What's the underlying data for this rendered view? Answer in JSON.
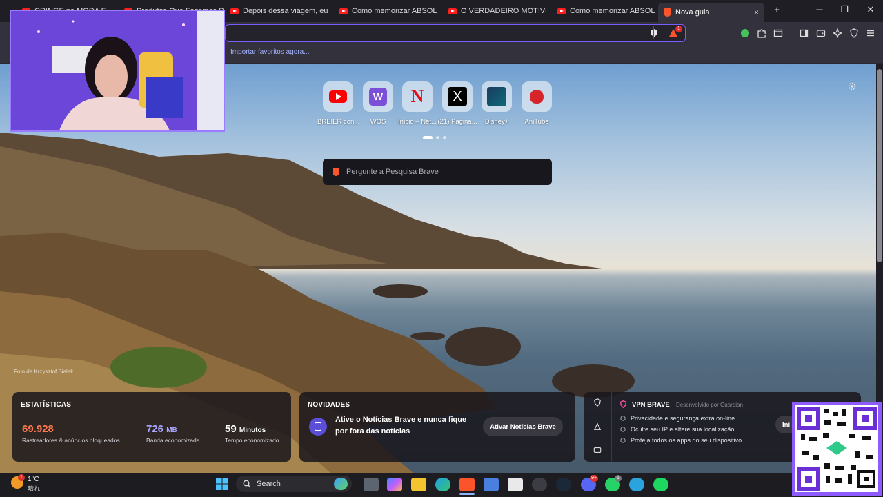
{
  "browser": {
    "tabs": [
      {
        "title": "CRINGE na MODA E..."
      },
      {
        "title": "Produtos Que Fazemos D..."
      },
      {
        "title": "Depois dessa viagem, eu pre..."
      },
      {
        "title": "Como memorizar ABSOLUTA..."
      },
      {
        "title": "O VERDADEIRO MOTIVO DE..."
      },
      {
        "title": "Como memorizar ABSOLUTA..."
      }
    ],
    "active_tab": "Nova guia",
    "new_tab_symbol": "+",
    "close_symbol": "×",
    "minimize_symbol": "─",
    "maximize_symbol": "❐",
    "window_close_symbol": "✕",
    "rewards_badge": "1",
    "import_bookmarks": "Importar favoritos agora..."
  },
  "newtab": {
    "top_sites": [
      {
        "label": "BREIER con...",
        "icon": "youtube-icon"
      },
      {
        "label": "WOS",
        "icon": "wos-icon"
      },
      {
        "label": "Início – Net...",
        "icon": "netflix-icon"
      },
      {
        "label": "(21) Página...",
        "icon": "x-icon"
      },
      {
        "label": "Disney+",
        "icon": "disney-icon"
      },
      {
        "label": "AniTube",
        "icon": "anitube-icon"
      }
    ],
    "search_placeholder": "Pergunte a Pesquisa Brave",
    "photo_credit": "Foto de Krzysztof Bialek",
    "stats": {
      "title": "ESTATÍSTICAS",
      "trackers_value": "69.928",
      "trackers_label": "Rastreadores & anúncios bloqueados",
      "bandwidth_value": "726",
      "bandwidth_unit": "MB",
      "bandwidth_label": "Banda economizada",
      "time_value": "59",
      "time_unit": "Minutos",
      "time_label": "Tempo economizado"
    },
    "news": {
      "title": "NOVIDADES",
      "text": "Ative o Notícias Brave e nunca fique por fora das notícias",
      "button": "Ativar Notícias Brave"
    },
    "vpn": {
      "title": "VPN BRAVE",
      "developed_by": "Desenvolvido por",
      "partner": "Guardian",
      "items": [
        "Privacidade e segurança extra on-line",
        "Oculte seu IP e altere sua localização",
        "Proteja todos os apps do seu dispositivo"
      ],
      "button_partial": "Ini"
    }
  },
  "taskbar": {
    "weather_temp": "1°C",
    "weather_desc": "晴れ",
    "weather_badge": "1",
    "search_label": "Search",
    "discord_badge": "9+",
    "whatsapp_badge": "1"
  },
  "colors": {
    "accent": "#7b5cff",
    "brave_orange": "#fb542b",
    "stat_trackers": "#ff7a50",
    "stat_bandwidth": "#a9a6ff",
    "vpn_pink": "#ff4fa0"
  }
}
